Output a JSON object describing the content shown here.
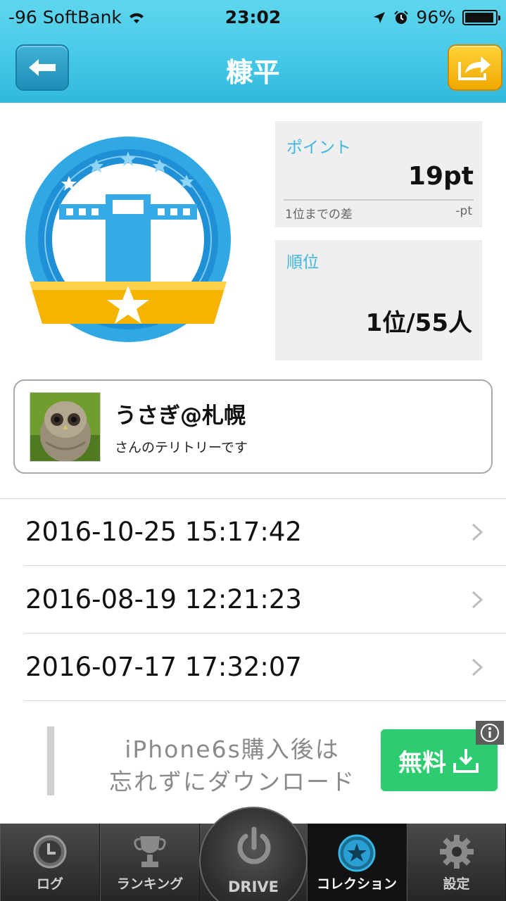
{
  "status_bar": {
    "carrier": "-96 SoftBank",
    "time": "23:02",
    "battery": "96%",
    "battery_level": 0.96
  },
  "header": {
    "title": "糠平",
    "back_icon": "arrow-left-icon",
    "share_icon": "share-icon"
  },
  "stats": {
    "points_label": "ポイント",
    "points_value": "19pt",
    "diff_label": "1位までの差",
    "diff_value": "-pt",
    "rank_label": "順位",
    "rank_value": "1位/55人"
  },
  "owner": {
    "name": "うさぎ@札幌",
    "subtitle": "さんのテリトリーです"
  },
  "history": [
    {
      "datetime": "2016-10-25 15:17:42"
    },
    {
      "datetime": "2016-08-19 12:21:23"
    },
    {
      "datetime": "2016-07-17 17:32:07"
    }
  ],
  "ad": {
    "line1": "iPhone6s購入後は",
    "line2": "忘れずにダウンロード",
    "button_label": "無料"
  },
  "tabs": {
    "log": "ログ",
    "ranking": "ランキング",
    "drive": "DRIVE",
    "collection": "コレクション",
    "settings": "設定"
  },
  "colors": {
    "header": "#47c9e8",
    "accent_blue": "#41b6df",
    "badge_blue": "#1f8fd6",
    "badge_gold": "#f5b400",
    "ad_green": "#2ecc71"
  }
}
